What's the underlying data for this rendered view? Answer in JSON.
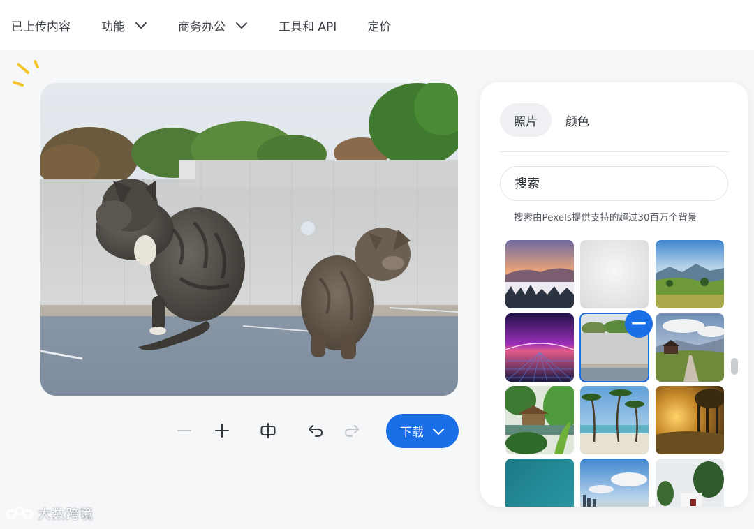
{
  "nav": {
    "items": [
      {
        "label": "已上传内容",
        "has_dropdown": false
      },
      {
        "label": "功能",
        "has_dropdown": true
      },
      {
        "label": "商务办公",
        "has_dropdown": true
      },
      {
        "label": "工具和 API",
        "has_dropdown": false
      },
      {
        "label": "定价",
        "has_dropdown": false
      }
    ]
  },
  "editor": {
    "image_description": "two tabby cats on a rooftop parking lot with concrete wall and trees",
    "download_label": "下载",
    "accent_color": "#1b6fe6"
  },
  "panel": {
    "tabs": [
      {
        "label": "照片",
        "active": true
      },
      {
        "label": "颜色",
        "active": false
      }
    ],
    "search_placeholder": "搜索",
    "caption": "搜索由Pexels提供支持的超过30百万个背景",
    "thumbnails": [
      "sunset-sea-of-clouds",
      "white-wall",
      "mountain-meadow",
      "purple-neon-pier",
      "concrete-wall-selected",
      "cabin-path-hills",
      "tropical-gazebo",
      "palm-beach",
      "golden-forest-sunset",
      "teal-water",
      "city-beach-sky",
      "white-building-trees"
    ],
    "selected_index": 4
  },
  "watermark": {
    "text": "大数跨境"
  }
}
